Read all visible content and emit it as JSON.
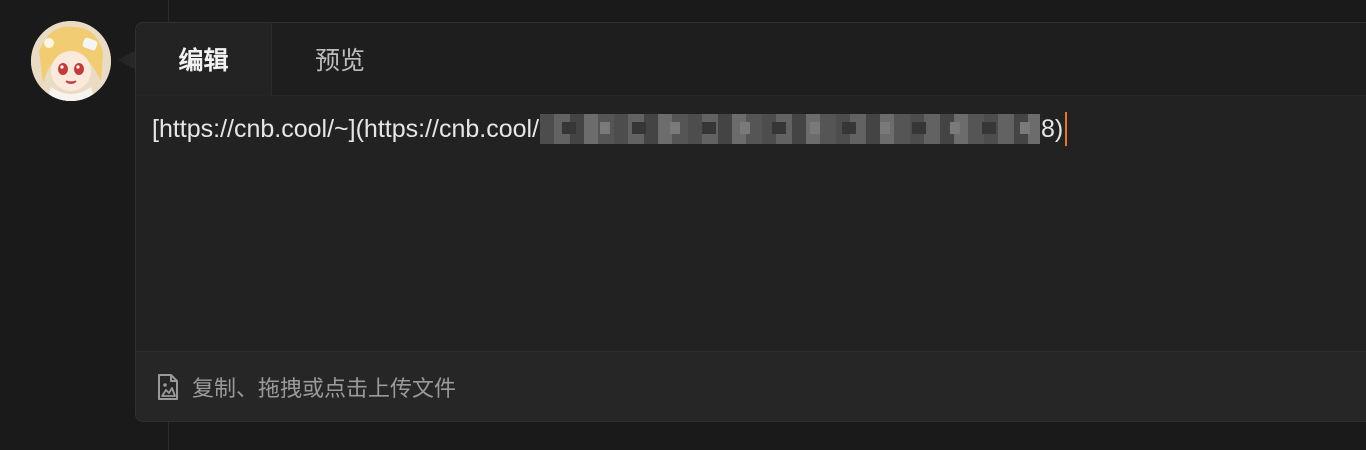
{
  "tabs": {
    "edit_label": "编辑",
    "preview_label": "预览"
  },
  "editor": {
    "text_prefix": "[https://cnb.cool/~](https://cnb.cool/",
    "text_suffix": "8)"
  },
  "footer": {
    "upload_hint": "复制、拖拽或点击上传文件",
    "upload_icon": "image-file-icon"
  },
  "colors": {
    "caret": "#e8743b",
    "background": "#1a1a1a",
    "card": "#222222"
  }
}
